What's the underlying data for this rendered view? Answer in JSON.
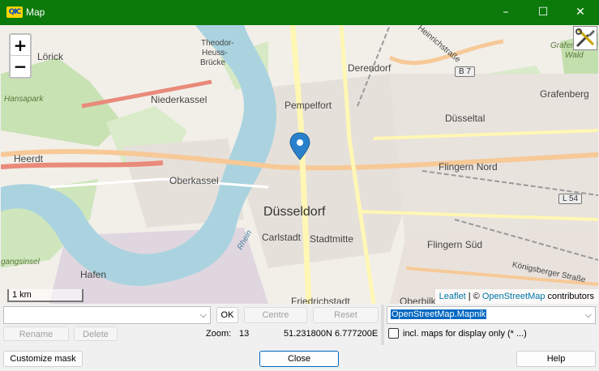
{
  "window": {
    "title": "Map",
    "app_icon": "QIC",
    "controls": {
      "minimize": "–",
      "maximize": "☐",
      "close": "✕"
    }
  },
  "map": {
    "zoom_in": "+",
    "zoom_out": "−",
    "tool_icon": "map-tools-icon",
    "scale_label": "1 km",
    "attribution": {
      "leaflet": "Leaflet",
      "separator": " | © ",
      "osm": "OpenStreetMap",
      "suffix": " contributors"
    },
    "places": {
      "lorick": "Lörick",
      "hansapark": "Hansapark",
      "niederkassel": "Niederkassel",
      "heerdt": "Heerdt",
      "oberkassel": "Oberkassel",
      "theodor": "Theodor-",
      "heuss": "Heuss-",
      "brucke": "Brücke",
      "pempelfort": "Pempelfort",
      "derendorf": "Derendorf",
      "dusseltal": "Düsseltal",
      "grafenberg": "Grafenberg",
      "flingern_nord": "Flingern Nord",
      "dusseldorf": "Düsseldorf",
      "carlstadt": "Carlstadt",
      "stadtmitte": "Stadtmitte",
      "flingern_sud": "Flingern Süd",
      "hafen": "Hafen",
      "gangsinsel": "gangsinsel",
      "friedrichstadt": "Friedrichstadt",
      "oberbilk": "Oberbilk",
      "heinrichstrasse": "Heinrichstraße",
      "grafenberger": "Grafenberger",
      "wald": "Wald",
      "rhein": "Rhein",
      "konigsberger": "Königsberger Straße"
    },
    "shields": {
      "b7": "B 7",
      "l54": "L 54"
    }
  },
  "controls": {
    "search_value": "",
    "ok": "OK",
    "centre": "Centre",
    "reset": "Reset",
    "rename": "Rename",
    "delete": "Delete",
    "zoom_label": "Zoom:",
    "zoom_value": "13",
    "coords": "51.231800N 6.777200E",
    "map_source": "OpenStreetMap.Mapnik",
    "incl_maps_label": "incl. maps for display only (* ...)",
    "customize_mask": "Customize mask",
    "close": "Close",
    "help": "Help"
  }
}
